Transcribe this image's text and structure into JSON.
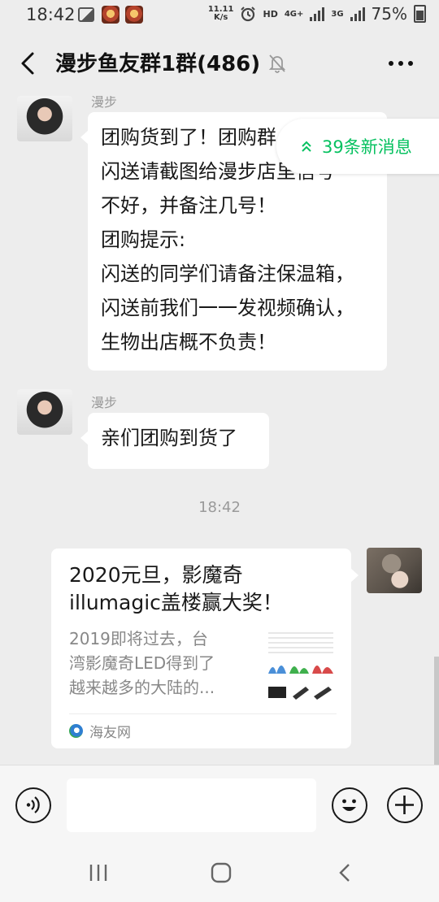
{
  "status_bar": {
    "time": "18:42",
    "net_speed_top": "11.11",
    "net_speed_bottom": "K/s",
    "hd_label": "HD",
    "network_4g": "4G+",
    "network_3g": "3G",
    "battery_percent": "75%"
  },
  "header": {
    "title": "漫步鱼友群1群(486)",
    "back_icon": "chevron-left-icon",
    "mute_icon": "bell-muted-icon",
    "more_icon": "more-dots-icon"
  },
  "new_messages_pill": {
    "label": "39条新消息"
  },
  "messages": [
    {
      "sender": "漫步",
      "lines": [
        "团购货到了！团购群",
        "闪送请截图给漫步店里信号",
        "不好，并备注几号！",
        "团购提示:",
        "闪送的同学们请备注保温箱，",
        "闪送前我们一一发视频确认，",
        "生物出店概不负责！"
      ]
    },
    {
      "sender": "漫步",
      "lines": [
        "亲们团购到货了"
      ]
    }
  ],
  "timestamp": "18:42",
  "link_card": {
    "title_line1": "2020元旦，影魔奇",
    "title_line2": "illumagic盖楼赢大奖！",
    "desc_line1": "2019即将过去，台",
    "desc_line2": "湾影魔奇LED得到了",
    "desc_line3": "越来越多的大陆的...",
    "source": "海友网"
  },
  "input_bar": {
    "voice_icon": "voice-icon",
    "emoji_icon": "emoji-icon",
    "plus_icon": "plus-icon",
    "input_value": ""
  },
  "nav_bar": {
    "recents_icon": "recents-icon",
    "home_icon": "home-icon",
    "back_icon": "back-icon"
  },
  "colors": {
    "accent_green": "#07c160",
    "background": "#ededed",
    "bubble": "#ffffff"
  }
}
